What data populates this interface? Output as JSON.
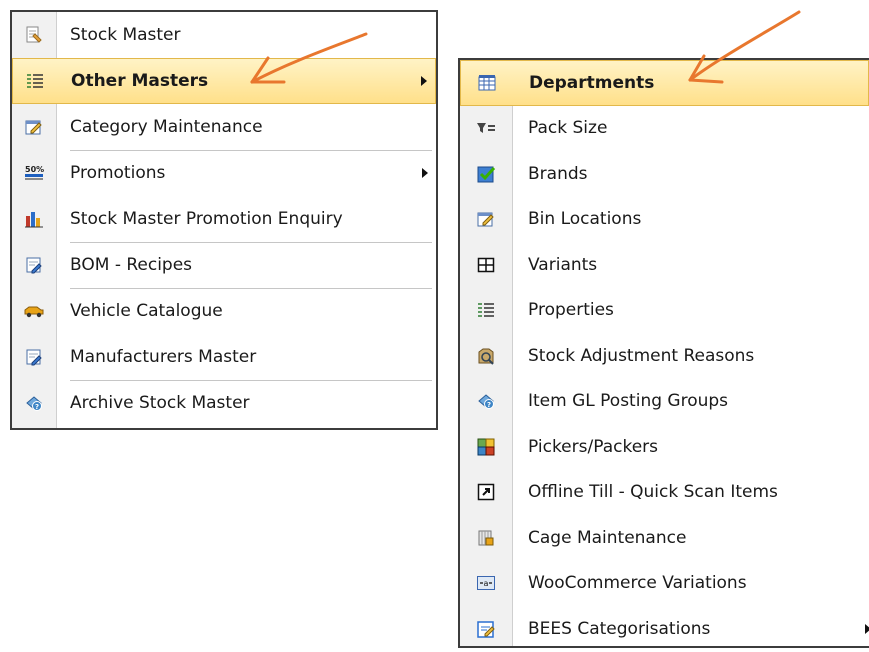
{
  "left_menu": {
    "items": [
      {
        "label": "Stock Master",
        "icon": "stock-master-icon"
      },
      {
        "label": "Other Masters",
        "icon": "other-masters-icon",
        "highlighted": true,
        "submenu": true
      },
      {
        "label": "Category Maintenance",
        "icon": "category-icon"
      },
      {
        "label": "Promotions",
        "icon": "promotions-icon",
        "submenu": true
      },
      {
        "label": "Stock Master Promotion Enquiry",
        "icon": "promotion-enquiry-icon"
      },
      {
        "label": "BOM - Recipes",
        "icon": "bom-recipes-icon"
      },
      {
        "label": "Vehicle Catalogue",
        "icon": "vehicle-icon"
      },
      {
        "label": "Manufacturers Master",
        "icon": "manufacturers-icon"
      },
      {
        "label": "Archive Stock Master",
        "icon": "archive-icon"
      }
    ]
  },
  "right_menu": {
    "items": [
      {
        "label": "Departments",
        "icon": "departments-icon",
        "highlighted": true
      },
      {
        "label": "Pack Size",
        "icon": "pack-size-icon"
      },
      {
        "label": "Brands",
        "icon": "brands-icon"
      },
      {
        "label": "Bin Locations",
        "icon": "bin-locations-icon"
      },
      {
        "label": "Variants",
        "icon": "variants-icon"
      },
      {
        "label": "Properties",
        "icon": "properties-icon"
      },
      {
        "label": "Stock Adjustment Reasons",
        "icon": "adjustment-icon"
      },
      {
        "label": "Item GL Posting Groups",
        "icon": "gl-posting-icon"
      },
      {
        "label": "Pickers/Packers",
        "icon": "pickers-icon"
      },
      {
        "label": "Offline Till - Quick Scan Items",
        "icon": "shortcut-icon"
      },
      {
        "label": "Cage Maintenance",
        "icon": "cage-icon"
      },
      {
        "label": "WooCommerce Variations",
        "icon": "woocommerce-icon"
      },
      {
        "label": "BEES Categorisations",
        "icon": "bees-icon",
        "submenu": true
      }
    ]
  },
  "colors": {
    "highlight_top": "#fff3c6",
    "highlight_bottom": "#ffe08a",
    "annotation_arrow": "#e8772e"
  }
}
